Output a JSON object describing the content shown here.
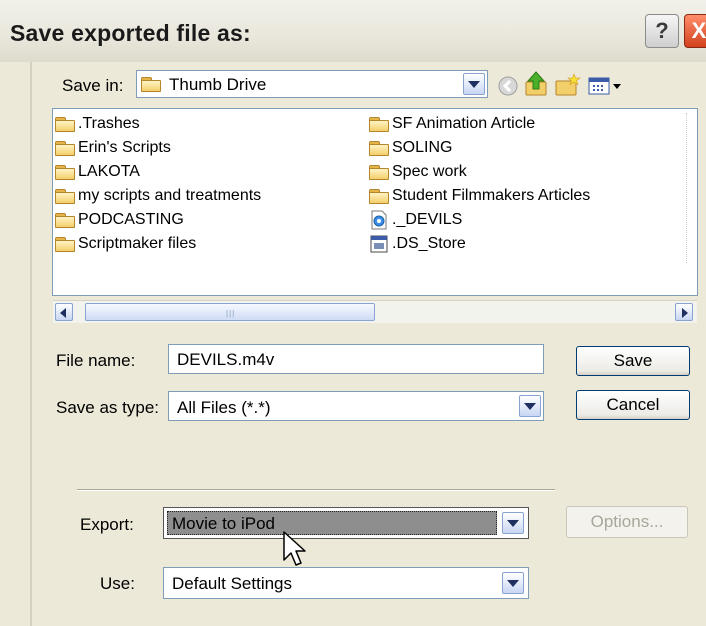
{
  "window": {
    "title": "Save exported file as:",
    "help": "?",
    "close": "X"
  },
  "save_in": {
    "label": "Save in:",
    "value": "Thumb Drive"
  },
  "files": {
    "left": [
      ".Trashes",
      "Erin's Scripts",
      "LAKOTA",
      "my scripts and treatments",
      "PODCASTING",
      "Scriptmaker files"
    ],
    "right": [
      "SF Animation Article",
      "SOLING",
      "Spec work",
      "Student Filmmakers Articles",
      "._DEVILS",
      ".DS_Store"
    ]
  },
  "file_name": {
    "label": "File name:",
    "value": "DEVILS.m4v"
  },
  "save_as_type": {
    "label": "Save as type:",
    "value": "All Files (*.*)"
  },
  "buttons": {
    "save": "Save",
    "cancel": "Cancel",
    "options": "Options..."
  },
  "export": {
    "label": "Export:",
    "value": "Movie to iPod"
  },
  "use": {
    "label": "Use:",
    "value": "Default Settings"
  },
  "colors": {
    "dialog_bg": "#ece9d8",
    "field_border": "#7f9db9",
    "highlight": "#8e8e8e",
    "close_red": "#d2411d"
  },
  "icons": [
    "help-icon",
    "close-icon",
    "folder-icon",
    "back-icon",
    "up-folder-icon",
    "new-folder-icon",
    "views-menu-icon",
    "quicktime-file-icon",
    "ds-store-file-icon",
    "mouse-cursor-icon"
  ]
}
